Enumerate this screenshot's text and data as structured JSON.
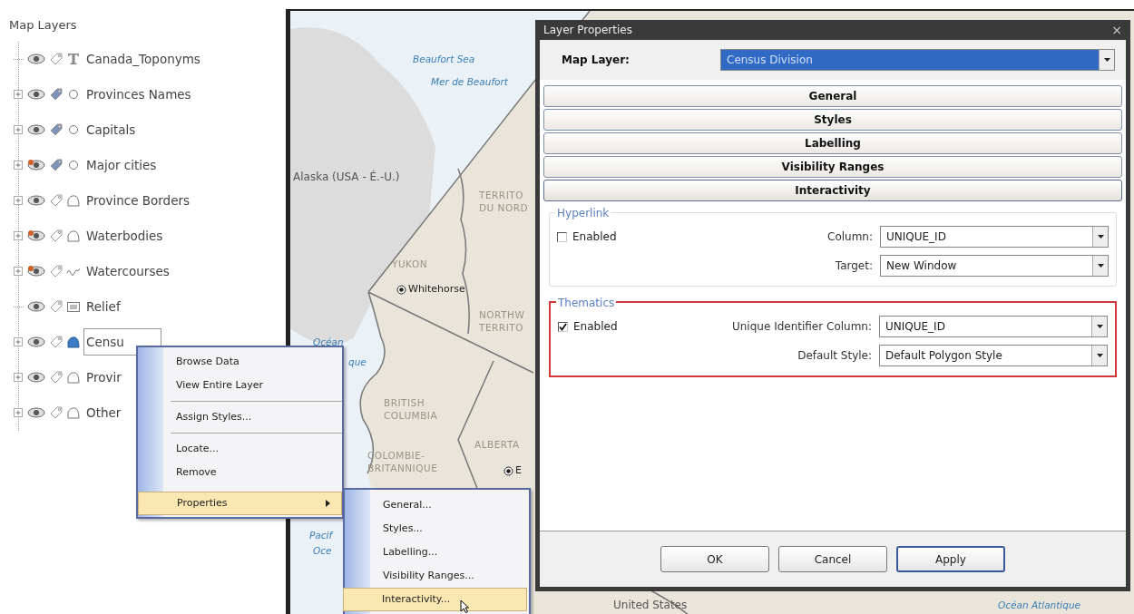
{
  "layers_panel": {
    "title": "Map Layers",
    "layers": [
      {
        "name": "Canada_Toponyms",
        "expandable": false,
        "flagged": false,
        "labels_on": false,
        "kind": "text",
        "selected": false
      },
      {
        "name": "Provinces Names",
        "expandable": true,
        "flagged": false,
        "labels_on": true,
        "kind": "point",
        "selected": false
      },
      {
        "name": "Capitals",
        "expandable": true,
        "flagged": false,
        "labels_on": true,
        "kind": "point",
        "selected": false
      },
      {
        "name": "Major cities",
        "expandable": true,
        "flagged": true,
        "labels_on": true,
        "kind": "point",
        "selected": false
      },
      {
        "name": "Province Borders",
        "expandable": true,
        "flagged": false,
        "labels_on": false,
        "kind": "polygon",
        "selected": false
      },
      {
        "name": "Waterbodies",
        "expandable": true,
        "flagged": true,
        "labels_on": false,
        "kind": "polygon",
        "selected": false
      },
      {
        "name": "Watercourses",
        "expandable": true,
        "flagged": true,
        "labels_on": false,
        "kind": "line",
        "selected": false
      },
      {
        "name": "Relief",
        "expandable": false,
        "flagged": false,
        "labels_on": false,
        "kind": "raster",
        "selected": false
      },
      {
        "name": "Censu",
        "expandable": true,
        "flagged": false,
        "labels_on": false,
        "kind": "polygon",
        "selected": true
      },
      {
        "name": "Provir",
        "expandable": true,
        "flagged": false,
        "labels_on": false,
        "kind": "polygon",
        "selected": false
      },
      {
        "name": "Other",
        "expandable": true,
        "flagged": false,
        "labels_on": false,
        "kind": "polygon",
        "selected": false
      }
    ]
  },
  "map": {
    "labels": [
      {
        "lines": [
          "Beaufort Sea"
        ],
        "kind": "sea"
      },
      {
        "lines": [
          "Mer de Beaufort"
        ],
        "kind": "sea"
      },
      {
        "lines": [
          "Alaska (USA - É.-U.)"
        ],
        "kind": "land"
      },
      {
        "lines": [
          "TERRITO",
          "DU NORD"
        ],
        "kind": "region"
      },
      {
        "lines": [
          "YUKON"
        ],
        "kind": "region"
      },
      {
        "lines": [
          "Whitehorse"
        ],
        "kind": "city"
      },
      {
        "lines": [
          "NORTHW",
          "TERRITO"
        ],
        "kind": "region"
      },
      {
        "lines": [
          "Océan"
        ],
        "kind": "sea"
      },
      {
        "lines": [
          "que"
        ],
        "kind": "sea"
      },
      {
        "lines": [
          "BRITISH",
          "COLUMBIA"
        ],
        "kind": "region"
      },
      {
        "lines": [
          "ALBERTA"
        ],
        "kind": "region"
      },
      {
        "lines": [
          "COLOMBIE-",
          "BRITANNIQUE"
        ],
        "kind": "region"
      },
      {
        "lines": [
          "E"
        ],
        "kind": "city"
      },
      {
        "lines": [
          "Pacif"
        ],
        "kind": "sea"
      },
      {
        "lines": [
          "Oce"
        ],
        "kind": "sea"
      },
      {
        "lines": [
          "United States"
        ],
        "kind": "land"
      },
      {
        "lines": [
          "Océan Atlantique"
        ],
        "kind": "sea"
      }
    ]
  },
  "context_menu": {
    "items": [
      {
        "kind": "item",
        "label": "Browse Data",
        "selected": false,
        "submenu": false
      },
      {
        "kind": "item",
        "label": "View Entire Layer",
        "selected": false,
        "submenu": false
      },
      {
        "kind": "separator"
      },
      {
        "kind": "item",
        "label": "Assign Styles...",
        "selected": false,
        "submenu": false
      },
      {
        "kind": "separator"
      },
      {
        "kind": "item",
        "label": "Locate...",
        "selected": false,
        "submenu": false
      },
      {
        "kind": "item",
        "label": "Remove",
        "selected": false,
        "submenu": false
      },
      {
        "kind": "item",
        "label": "Properties",
        "selected": true,
        "submenu": true
      }
    ]
  },
  "submenu": {
    "items": [
      {
        "label": "General...",
        "selected": false
      },
      {
        "label": "Styles...",
        "selected": false
      },
      {
        "label": "Labelling...",
        "selected": false
      },
      {
        "label": "Visibility Ranges...",
        "selected": false
      },
      {
        "label": "Interactivity...",
        "selected": true
      }
    ]
  },
  "dialog": {
    "title": "Layer Properties",
    "close": "×",
    "map_layer": {
      "label": "Map Layer:",
      "value": "Census Division"
    },
    "sections": [
      {
        "label": "General",
        "expanded": false
      },
      {
        "label": "Styles",
        "expanded": false
      },
      {
        "label": "Labelling",
        "expanded": false
      },
      {
        "label": "Visibility Ranges",
        "expanded": false
      },
      {
        "label": "Interactivity",
        "expanded": true
      }
    ],
    "groups": [
      {
        "title": "Hyperlink",
        "highlighted": false,
        "checkbox": {
          "label": "Enabled",
          "checked": false
        },
        "fields": [
          {
            "label": "Column:",
            "value": "UNIQUE_ID"
          },
          {
            "label": "Target:",
            "value": "New Window"
          }
        ]
      },
      {
        "title": "Thematics",
        "highlighted": true,
        "checkbox": {
          "label": "Enabled",
          "checked": true
        },
        "fields": [
          {
            "label": "Unique Identifier Column:",
            "value": "UNIQUE_ID"
          },
          {
            "label": "Default Style:",
            "value": "Default Polygon Style"
          }
        ]
      }
    ],
    "buttons": [
      {
        "label": "OK",
        "default": false
      },
      {
        "label": "Cancel",
        "default": false
      },
      {
        "label": "Apply",
        "default": true
      }
    ]
  }
}
